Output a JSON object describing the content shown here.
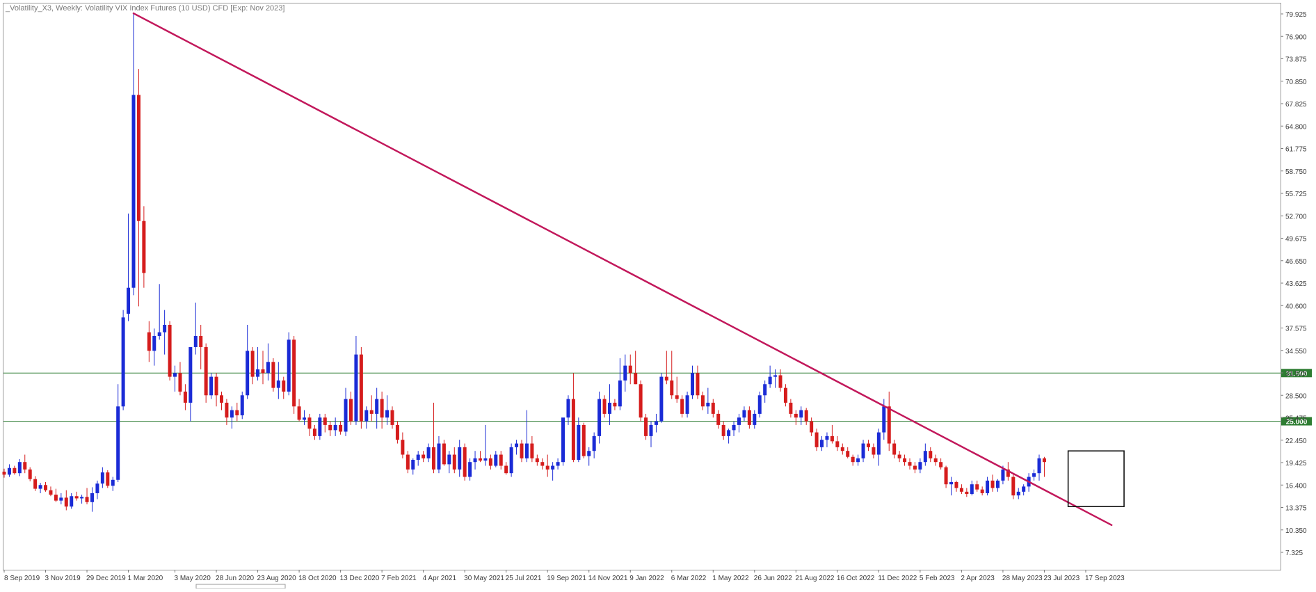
{
  "chart_data": {
    "type": "candlestick",
    "title": "_Volatility_X3, Weekly:  Volatility VIX Index Futures (10 USD) CFD [Exp: Nov 2023]",
    "timeframe": "Weekly",
    "ylim": [
      4.7,
      81.0
    ],
    "y_ticks": [
      "79.925",
      "76.900",
      "73.875",
      "70.850",
      "67.825",
      "64.800",
      "61.775",
      "58.750",
      "55.725",
      "52.700",
      "49.675",
      "46.650",
      "43.625",
      "40.600",
      "37.575",
      "34.550",
      "31.525",
      "28.500",
      "25.475",
      "22.450",
      "19.425",
      "16.400",
      "13.375",
      "10.350",
      "7.325"
    ],
    "x_tick_labels": [
      "8 Sep 2019",
      "3 Nov 2019",
      "29 Dec 2019",
      "1 Mar 2020",
      "3 May 2020",
      "28 Jun 2020",
      "23 Aug 2020",
      "18 Oct 2020",
      "13 Dec 2020",
      "7 Feb 2021",
      "4 Apr 2021",
      "30 May 2021",
      "25 Jul 2021",
      "19 Sep 2021",
      "14 Nov 2021",
      "9 Jan 2022",
      "6 Mar 2022",
      "1 May 2022",
      "26 Jun 2022",
      "21 Aug 2022",
      "16 Oct 2022",
      "11 Dec 2022",
      "5 Feb 2023",
      "2 Apr 2023",
      "28 May 2023",
      "23 Jul 2023",
      "17 Sep 2023"
    ],
    "x_tick_bar_index": [
      0,
      8,
      16,
      24,
      33,
      41,
      49,
      57,
      65,
      73,
      81,
      89,
      97,
      105,
      113,
      121,
      129,
      137,
      145,
      153,
      161,
      169,
      177,
      185,
      193,
      201,
      209
    ],
    "up_color": "#1a2bd6",
    "down_color": "#d51c1c",
    "candles": [
      [
        18.2,
        18.6,
        17.4,
        17.8
      ],
      [
        17.8,
        19.2,
        17.5,
        18.7
      ],
      [
        18.7,
        19.0,
        17.8,
        18.0
      ],
      [
        18.0,
        19.9,
        17.6,
        19.5
      ],
      [
        19.5,
        20.5,
        18.0,
        18.5
      ],
      [
        18.5,
        18.8,
        16.9,
        17.2
      ],
      [
        17.2,
        17.6,
        15.6,
        15.9
      ],
      [
        15.9,
        16.7,
        15.3,
        16.4
      ],
      [
        16.4,
        16.8,
        15.5,
        15.7
      ],
      [
        15.7,
        16.2,
        14.9,
        15.1
      ],
      [
        15.1,
        15.9,
        14.1,
        14.3
      ],
      [
        14.3,
        15.3,
        13.8,
        14.7
      ],
      [
        14.7,
        15.7,
        13.0,
        13.5
      ],
      [
        13.5,
        15.3,
        13.2,
        14.9
      ],
      [
        14.9,
        15.5,
        14.3,
        14.6
      ],
      [
        14.6,
        15.1,
        13.9,
        14.8
      ],
      [
        14.8,
        16.0,
        13.8,
        14.1
      ],
      [
        14.1,
        16.1,
        12.8,
        15.3
      ],
      [
        15.3,
        17.0,
        14.5,
        16.6
      ],
      [
        16.6,
        18.8,
        16.0,
        18.1
      ],
      [
        18.1,
        18.4,
        16.0,
        16.3
      ],
      [
        16.3,
        17.5,
        15.6,
        17.1
      ],
      [
        17.1,
        30.0,
        16.8,
        27.0
      ],
      [
        27.0,
        40.0,
        26.5,
        39.0
      ],
      [
        39.5,
        53.0,
        38.5,
        43.0
      ],
      [
        43.0,
        80.0,
        42.0,
        69.0
      ],
      [
        69.0,
        72.5,
        40.5,
        52.0
      ],
      [
        52.0,
        54.0,
        43.0,
        45.0
      ],
      [
        37.0,
        38.5,
        33.0,
        34.5
      ],
      [
        34.5,
        37.5,
        32.5,
        36.5
      ],
      [
        36.5,
        43.5,
        36.0,
        37.0
      ],
      [
        37.0,
        40.0,
        34.0,
        38.0
      ],
      [
        38.0,
        38.5,
        30.5,
        31.0
      ],
      [
        31.0,
        32.5,
        29.0,
        31.5
      ],
      [
        31.5,
        33.0,
        28.5,
        29.0
      ],
      [
        29.0,
        30.0,
        26.5,
        27.5
      ],
      [
        27.5,
        35.0,
        25.0,
        35.0
      ],
      [
        35.0,
        41.0,
        34.0,
        36.5
      ],
      [
        36.5,
        38.0,
        32.0,
        35.0
      ],
      [
        35.0,
        35.5,
        27.5,
        28.5
      ],
      [
        28.5,
        31.5,
        28.0,
        31.0
      ],
      [
        31.0,
        31.5,
        27.0,
        28.5
      ],
      [
        28.5,
        29.0,
        26.5,
        27.5
      ],
      [
        27.5,
        28.0,
        24.5,
        25.5
      ],
      [
        25.5,
        27.0,
        24.0,
        26.5
      ],
      [
        26.5,
        27.5,
        25.0,
        25.8
      ],
      [
        25.8,
        29.0,
        25.3,
        28.5
      ],
      [
        28.5,
        38.0,
        28.0,
        34.5
      ],
      [
        34.5,
        35.0,
        30.0,
        31.0
      ],
      [
        31.0,
        35.0,
        30.5,
        32.0
      ],
      [
        32.0,
        34.5,
        30.0,
        31.5
      ],
      [
        31.5,
        35.5,
        30.5,
        33.0
      ],
      [
        33.0,
        33.5,
        29.0,
        29.5
      ],
      [
        29.5,
        33.0,
        28.0,
        30.5
      ],
      [
        30.5,
        31.0,
        28.0,
        29.0
      ],
      [
        29.0,
        37.0,
        28.5,
        36.0
      ],
      [
        36.0,
        36.5,
        26.0,
        27.0
      ],
      [
        27.0,
        28.0,
        25.0,
        25.2
      ],
      [
        25.2,
        26.5,
        24.5,
        25.5
      ],
      [
        25.5,
        26.0,
        23.0,
        24.0
      ],
      [
        24.0,
        24.5,
        22.5,
        23.0
      ],
      [
        23.0,
        26.0,
        22.5,
        25.5
      ],
      [
        25.5,
        26.0,
        23.5,
        24.5
      ],
      [
        24.5,
        25.0,
        23.0,
        23.8
      ],
      [
        23.8,
        25.5,
        23.0,
        24.5
      ],
      [
        24.5,
        25.0,
        23.2,
        23.6
      ],
      [
        23.6,
        29.5,
        23.0,
        28.0
      ],
      [
        28.0,
        29.0,
        24.5,
        25.0
      ],
      [
        25.0,
        36.5,
        24.5,
        34.0
      ],
      [
        34.0,
        35.0,
        24.0,
        25.0
      ],
      [
        25.0,
        27.0,
        24.0,
        26.5
      ],
      [
        26.5,
        28.5,
        25.0,
        26.0
      ],
      [
        26.0,
        29.5,
        24.0,
        28.0
      ],
      [
        28.0,
        29.0,
        24.0,
        25.5
      ],
      [
        25.5,
        28.5,
        24.5,
        26.5
      ],
      [
        26.5,
        27.0,
        24.0,
        24.5
      ],
      [
        24.5,
        25.0,
        22.0,
        22.5
      ],
      [
        22.5,
        23.5,
        20.0,
        20.5
      ],
      [
        20.5,
        21.0,
        18.0,
        18.5
      ],
      [
        18.5,
        20.0,
        17.8,
        19.8
      ],
      [
        19.8,
        21.0,
        19.0,
        20.5
      ],
      [
        20.5,
        21.0,
        19.5,
        20.0
      ],
      [
        20.0,
        22.0,
        19.5,
        21.5
      ],
      [
        21.5,
        27.5,
        18.0,
        18.5
      ],
      [
        18.5,
        23.0,
        18.0,
        22.0
      ],
      [
        22.0,
        22.5,
        19.0,
        19.2
      ],
      [
        19.2,
        21.0,
        18.0,
        20.5
      ],
      [
        20.5,
        21.5,
        18.0,
        18.5
      ],
      [
        18.5,
        22.5,
        17.5,
        21.5
      ],
      [
        21.5,
        22.0,
        17.0,
        17.5
      ],
      [
        17.5,
        20.0,
        17.0,
        19.5
      ],
      [
        19.5,
        21.0,
        18.5,
        20.0
      ],
      [
        20.0,
        21.0,
        19.5,
        19.7
      ],
      [
        19.7,
        24.5,
        19.0,
        20.0
      ],
      [
        20.0,
        20.5,
        18.5,
        19.0
      ],
      [
        19.0,
        21.0,
        18.8,
        20.5
      ],
      [
        20.5,
        21.0,
        18.5,
        19.0
      ],
      [
        19.0,
        19.5,
        17.8,
        18.0
      ],
      [
        18.0,
        22.0,
        17.5,
        21.5
      ],
      [
        21.5,
        22.5,
        20.5,
        22.0
      ],
      [
        22.0,
        22.5,
        19.5,
        20.0
      ],
      [
        20.0,
        26.5,
        19.5,
        22.0
      ],
      [
        22.0,
        23.0,
        19.5,
        20.0
      ],
      [
        20.0,
        20.5,
        19.0,
        19.5
      ],
      [
        19.5,
        20.0,
        18.5,
        19.0
      ],
      [
        19.0,
        20.5,
        17.5,
        18.5
      ],
      [
        18.5,
        19.5,
        17.0,
        19.0
      ],
      [
        19.0,
        20.0,
        18.5,
        19.5
      ],
      [
        19.5,
        24.5,
        19.0,
        25.5
      ],
      [
        25.5,
        28.5,
        24.5,
        28.0
      ],
      [
        28.0,
        31.5,
        19.5,
        19.8
      ],
      [
        19.8,
        25.5,
        19.5,
        24.5
      ],
      [
        24.5,
        24.8,
        20.0,
        20.3
      ],
      [
        20.3,
        21.5,
        19.0,
        21.0
      ],
      [
        21.0,
        23.5,
        20.0,
        23.0
      ],
      [
        23.0,
        29.0,
        22.0,
        28.0
      ],
      [
        28.0,
        28.5,
        25.5,
        26.0
      ],
      [
        26.0,
        30.0,
        24.5,
        27.5
      ],
      [
        27.5,
        28.0,
        26.5,
        27.0
      ],
      [
        27.0,
        33.5,
        26.5,
        30.5
      ],
      [
        30.5,
        34.0,
        29.0,
        32.5
      ],
      [
        32.5,
        34.0,
        30.0,
        31.5
      ],
      [
        31.5,
        34.5,
        30.0,
        30.0
      ],
      [
        30.0,
        30.5,
        25.0,
        25.5
      ],
      [
        25.5,
        26.0,
        22.5,
        23.0
      ],
      [
        23.0,
        25.0,
        21.5,
        24.5
      ],
      [
        24.5,
        26.0,
        23.5,
        25.0
      ],
      [
        25.0,
        31.5,
        24.8,
        31.0
      ],
      [
        31.0,
        34.5,
        30.0,
        30.5
      ],
      [
        30.5,
        34.5,
        28.0,
        28.5
      ],
      [
        28.5,
        31.0,
        27.5,
        28.0
      ],
      [
        28.0,
        28.5,
        25.5,
        26.0
      ],
      [
        26.0,
        29.0,
        25.5,
        28.5
      ],
      [
        28.5,
        32.5,
        28.0,
        31.5
      ],
      [
        31.5,
        32.5,
        28.0,
        28.5
      ],
      [
        28.5,
        29.0,
        26.5,
        27.0
      ],
      [
        27.0,
        29.5,
        26.0,
        27.5
      ],
      [
        27.5,
        28.0,
        25.5,
        26.0
      ],
      [
        26.0,
        26.5,
        24.0,
        24.5
      ],
      [
        24.5,
        25.0,
        22.5,
        23.0
      ],
      [
        23.0,
        24.0,
        22.0,
        23.8
      ],
      [
        23.8,
        25.0,
        23.0,
        24.5
      ],
      [
        24.5,
        26.0,
        23.5,
        25.5
      ],
      [
        25.5,
        27.0,
        25.0,
        26.5
      ],
      [
        26.5,
        27.0,
        24.0,
        24.5
      ],
      [
        24.5,
        26.5,
        24.0,
        26.0
      ],
      [
        26.0,
        29.0,
        25.5,
        28.5
      ],
      [
        28.5,
        30.5,
        27.5,
        30.0
      ],
      [
        30.0,
        32.5,
        29.5,
        31.0
      ],
      [
        31.0,
        32.0,
        29.5,
        31.2
      ],
      [
        31.2,
        32.0,
        29.0,
        29.5
      ],
      [
        29.5,
        30.0,
        27.0,
        27.5
      ],
      [
        27.5,
        28.0,
        25.5,
        26.0
      ],
      [
        26.0,
        26.5,
        24.5,
        25.5
      ],
      [
        25.5,
        27.0,
        24.5,
        26.5
      ],
      [
        26.5,
        26.8,
        24.5,
        25.0
      ],
      [
        25.0,
        25.5,
        23.0,
        23.5
      ],
      [
        23.5,
        24.0,
        21.0,
        21.5
      ],
      [
        21.5,
        23.0,
        21.0,
        22.5
      ],
      [
        22.5,
        23.5,
        21.5,
        23.0
      ],
      [
        23.0,
        24.5,
        22.0,
        22.3
      ],
      [
        22.3,
        23.0,
        21.0,
        21.5
      ],
      [
        21.5,
        22.0,
        20.5,
        21.0
      ],
      [
        21.0,
        21.5,
        20.0,
        20.2
      ],
      [
        20.2,
        20.5,
        19.0,
        19.5
      ],
      [
        19.5,
        20.5,
        19.0,
        20.0
      ],
      [
        20.0,
        22.5,
        19.5,
        22.0
      ],
      [
        22.0,
        22.5,
        21.0,
        21.5
      ],
      [
        21.5,
        22.0,
        20.0,
        20.5
      ],
      [
        20.5,
        24.0,
        19.0,
        23.5
      ],
      [
        23.5,
        28.0,
        22.5,
        27.0
      ],
      [
        27.0,
        29.0,
        21.0,
        22.0
      ],
      [
        22.0,
        22.5,
        20.0,
        20.5
      ],
      [
        20.5,
        21.0,
        19.5,
        20.0
      ],
      [
        20.0,
        20.5,
        19.0,
        19.5
      ],
      [
        19.5,
        20.0,
        18.5,
        19.0
      ],
      [
        19.0,
        19.5,
        18.0,
        18.5
      ],
      [
        18.5,
        20.0,
        18.0,
        19.5
      ],
      [
        19.5,
        22.0,
        19.0,
        21.0
      ],
      [
        21.0,
        21.5,
        19.5,
        20.0
      ],
      [
        20.0,
        20.5,
        19.0,
        19.5
      ],
      [
        19.5,
        20.0,
        18.5,
        18.8
      ],
      [
        18.8,
        19.0,
        16.0,
        16.5
      ],
      [
        16.5,
        17.5,
        15.0,
        16.8
      ],
      [
        16.8,
        17.0,
        15.5,
        16.0
      ],
      [
        16.0,
        16.5,
        15.2,
        15.5
      ],
      [
        15.5,
        16.0,
        14.8,
        15.2
      ],
      [
        15.2,
        17.0,
        15.0,
        16.5
      ],
      [
        16.5,
        17.0,
        15.5,
        15.8
      ],
      [
        15.8,
        16.2,
        15.0,
        15.3
      ],
      [
        15.3,
        17.5,
        15.0,
        17.0
      ],
      [
        17.0,
        17.8,
        15.5,
        16.0
      ],
      [
        16.0,
        17.2,
        15.5,
        17.0
      ],
      [
        17.0,
        19.0,
        16.5,
        18.5
      ],
      [
        18.5,
        19.5,
        17.0,
        17.5
      ],
      [
        17.5,
        17.8,
        14.5,
        15.0
      ],
      [
        15.0,
        16.0,
        14.5,
        15.5
      ],
      [
        15.5,
        16.5,
        15.0,
        16.2
      ],
      [
        16.2,
        18.0,
        15.5,
        17.5
      ],
      [
        17.5,
        18.5,
        17.0,
        18.0
      ],
      [
        18.0,
        20.5,
        17.0,
        20.0
      ],
      [
        20.0,
        20.2,
        17.5,
        19.5
      ]
    ],
    "horizontal_levels": [
      {
        "value": 31.5,
        "label": "31.500",
        "color": "#2e7d32"
      },
      {
        "value": 25.0,
        "label": "25.000",
        "color": "#2e7d32"
      }
    ],
    "trendline": {
      "from": {
        "bar": 25,
        "value": 80.0
      },
      "to": {
        "bar": 214,
        "value": 11.0
      },
      "color": "#c2185b"
    },
    "highlight_box": {
      "from_bar": 206,
      "to_bar": 216,
      "low": 13.5,
      "high": 21.0
    }
  }
}
